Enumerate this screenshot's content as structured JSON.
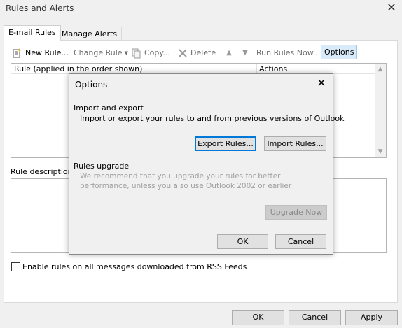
{
  "window": {
    "title": "Rules and Alerts",
    "close_glyph": "✕"
  },
  "tabs": [
    {
      "label": "E-mail Rules",
      "active": true
    },
    {
      "label": "Manage Alerts",
      "active": false
    }
  ],
  "toolbar": {
    "new_rule": "New Rule...",
    "change_rule": "Change Rule",
    "copy": "Copy...",
    "delete": "Delete",
    "run_rules_now": "Run Rules Now...",
    "options": "Options"
  },
  "rules_table": {
    "columns": [
      "Rule (applied in the order shown)",
      "Actions"
    ]
  },
  "rule_description_label": "Rule description",
  "rss_checkbox": {
    "label": "Enable rules on all messages downloaded from RSS Feeds",
    "checked": false
  },
  "main_buttons": {
    "ok": "OK",
    "cancel": "Cancel",
    "apply": "Apply"
  },
  "options_dialog": {
    "title": "Options",
    "import_export": {
      "heading": "Import and export",
      "description": "Import or export your rules to and from previous versions of Outlook",
      "export_button": "Export Rules...",
      "import_button": "Import Rules..."
    },
    "rules_upgrade": {
      "heading": "Rules upgrade",
      "description": "We recommend that you upgrade your rules for better performance, unless you also use Outlook 2002 or earlier",
      "upgrade_button": "Upgrade Now"
    },
    "ok": "OK",
    "cancel": "Cancel"
  },
  "colors": {
    "accent": "#0078d7",
    "options_highlight": "#d9ebf9",
    "disabled_text": "#a0a0a0"
  },
  "icons": [
    "new-rule-icon",
    "change-rule-icon",
    "copy-icon",
    "delete-icon",
    "move-up-icon",
    "move-down-icon",
    "close-icon"
  ]
}
